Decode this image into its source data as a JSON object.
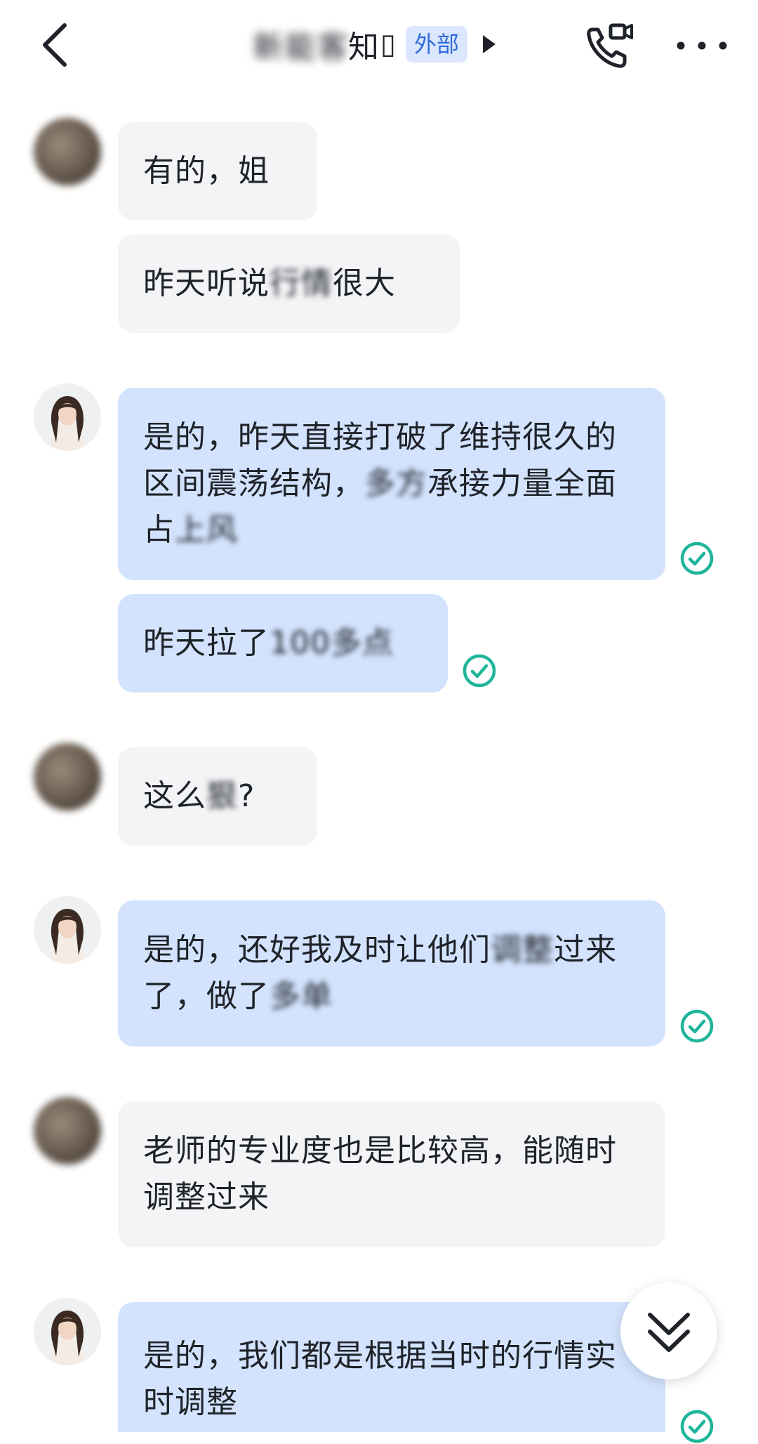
{
  "header": {
    "contact_name_blurred": "新能客",
    "contact_name_visible": "知",
    "badge": "外部",
    "back_icon": "chevron-left-icon",
    "call_icon": "video-call-icon",
    "more_icon": "more-dots-icon"
  },
  "colors": {
    "incoming_bubble": "#f3f4f6",
    "outgoing_bubble": "#d3e3fd",
    "read_check": "#1fb59a",
    "badge_bg": "#dbe6ff",
    "badge_text": "#2f6bd8"
  },
  "messages": [
    {
      "from": "peer",
      "parts": [
        "有的，姐"
      ]
    },
    {
      "from": "peer",
      "parts": [
        "昨天听说",
        "行情",
        "很大"
      ]
    },
    {
      "from": "me",
      "parts": [
        "是的，昨天直接打破了维持很久的区间震荡结构，",
        "多方",
        "承接力量全面占",
        "上风"
      ],
      "read": true
    },
    {
      "from": "me",
      "parts": [
        "昨天拉了",
        "100多点"
      ],
      "read": true
    },
    {
      "from": "peer",
      "parts": [
        "这么",
        "狠",
        "?"
      ]
    },
    {
      "from": "me",
      "parts": [
        "是的，还好我及时让他们",
        "调整",
        "过来了，做了",
        "多单"
      ],
      "read": true
    },
    {
      "from": "peer",
      "parts": [
        "老师的专业度也是比较高，能随时调整过来"
      ]
    },
    {
      "from": "me",
      "parts": [
        "是的，我们都是根据当时的行情实时调整"
      ],
      "read": true
    }
  ],
  "scroll_button_icon": "double-chevron-down-icon"
}
